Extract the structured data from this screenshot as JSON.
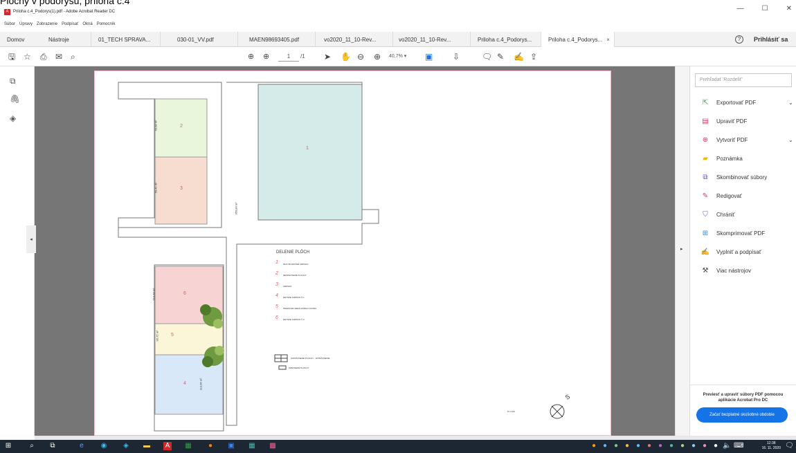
{
  "doc_caption": "Plochy v podorysu, príloha c.4",
  "window": {
    "title": "Priloha c.4_Podorys(1).pdf - Adobe Acrobat Reader DC",
    "minimize": "—",
    "maximize": "☐",
    "close": "✕"
  },
  "menu": [
    "Súbor",
    "Úpravy",
    "Zobrazenie",
    "Podpísať",
    "Okná",
    "Pomocník"
  ],
  "tabs": [
    {
      "label": "Domov"
    },
    {
      "label": "Nástroje"
    },
    {
      "label": "01_TECH SPRAVA..."
    },
    {
      "label": "030-01_VV.pdf"
    },
    {
      "label": "MAEN98693405.pdf"
    },
    {
      "label": "vo2020_11_10-Rev..."
    },
    {
      "label": "vo2020_11_10-Rev..."
    },
    {
      "label": "Priloha c.4_Podorys..."
    },
    {
      "label": "Priloha c.4_Podorys...",
      "close": "×"
    }
  ],
  "header": {
    "help": "?",
    "signin": "Prihlásiť sa"
  },
  "toolbar": {
    "page_current": "1",
    "page_total": "/1",
    "zoom": "40,7%"
  },
  "right_pane": {
    "search_placeholder": "Prehľadať 'Rozdeliť'",
    "tools": [
      {
        "label": "Exportovať PDF",
        "icon": "export-pdf-icon",
        "color": "#39a85a",
        "chevron": "⌄"
      },
      {
        "label": "Upraviť PDF",
        "icon": "edit-pdf-icon",
        "color": "#e0306a"
      },
      {
        "label": "Vytvoriť PDF",
        "icon": "create-pdf-icon",
        "color": "#e0306a",
        "chevron": "⌄"
      },
      {
        "label": "Poznámka",
        "icon": "comment-icon",
        "color": "#f2b705"
      },
      {
        "label": "Skombinovať súbory",
        "icon": "combine-files-icon",
        "color": "#6c4cd4"
      },
      {
        "label": "Redigovať",
        "icon": "redact-icon",
        "color": "#e0306a"
      },
      {
        "label": "Chrániť",
        "icon": "protect-icon",
        "color": "#5a5fd6"
      },
      {
        "label": "Skomprimovať PDF",
        "icon": "compress-pdf-icon",
        "color": "#2b8bd8"
      },
      {
        "label": "Vyplniť a podpísať",
        "icon": "fill-sign-icon",
        "color": "#8e5bd8"
      },
      {
        "label": "Viac nástrojov",
        "icon": "more-tools-icon",
        "color": "#444"
      }
    ],
    "promo_text": "Previesť a upraviť súbory PDF pomocou aplikácie Acrobat Pro DC",
    "promo_button": "Začať bezplatné skúšobné obdobie"
  },
  "plan": {
    "rooms": [
      {
        "num": "1",
        "area": "",
        "color": "#d5ebea"
      },
      {
        "num": "2",
        "area": "60,08 m²",
        "color": "#eaf6dc"
      },
      {
        "num": "3",
        "area": "60,41 m²",
        "color": "#f7ddd0"
      },
      {
        "num": "6",
        "area": "110,28 m²",
        "color": "#f7d3d3"
      },
      {
        "num": "5",
        "area": "95,75 m²",
        "color": "#fbf6d8"
      },
      {
        "num": "4",
        "area": "113,06 m²",
        "color": "#d9e8f8"
      }
    ],
    "corridor_area": "350,84 m²",
    "legend_title": "DELENIE PLÔCH",
    "legend": [
      {
        "num": "1",
        "text": "MULTIFUNKČNÉ IHRISKO"
      },
      {
        "num": "2",
        "text": "NESPEVNENÉ PLOCHY"
      },
      {
        "num": "3",
        "text": "IHRISKO"
      },
      {
        "num": "4",
        "text": "DETSKÉ IHRISKO Č.1"
      },
      {
        "num": "5",
        "text": "PRIESTOR AREÁLOVÉHO DVORA"
      },
      {
        "num": "6",
        "text": "DETSKÉ IHRISKO Č.2"
      }
    ],
    "key": [
      {
        "text": "ZATRÁVNENÉ PLOCHY - ZATRÁVNENIE"
      },
      {
        "text": "SPEVNENÉ PLOCHY"
      }
    ],
    "scale": "M 1:100",
    "north": "S"
  },
  "taskbar": {
    "time": "12:38",
    "date": "16. 11. 2020"
  }
}
